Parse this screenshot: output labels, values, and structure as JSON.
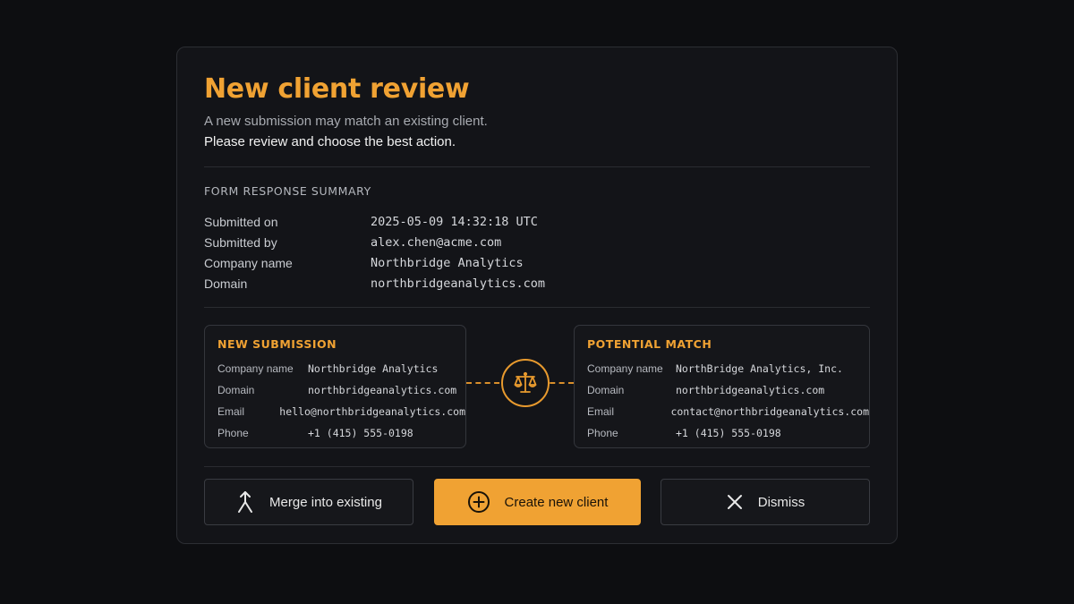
{
  "header": {
    "title": "New client review",
    "subtitle": "A new submission may match an existing client.",
    "instruction": "Please review and choose the best action."
  },
  "summary": {
    "section_title": "FORM RESPONSE SUMMARY",
    "rows": [
      {
        "label": "Submitted on",
        "value": "2025-05-09 14:32:18 UTC"
      },
      {
        "label": "Submitted by",
        "value": "alex.chen@acme.com"
      },
      {
        "label": "Company name",
        "value": "Northbridge Analytics"
      },
      {
        "label": "Domain",
        "value": "northbridgeanalytics.com"
      }
    ]
  },
  "new_submission": {
    "title": "NEW SUBMISSION",
    "rows": [
      {
        "label": "Company name",
        "value": "Northbridge Analytics"
      },
      {
        "label": "Domain",
        "value": "northbridgeanalytics.com"
      },
      {
        "label": "Email",
        "value": "hello@northbridgeanalytics.com"
      },
      {
        "label": "Phone",
        "value": "+1 (415) 555-0198"
      }
    ]
  },
  "potential_match": {
    "title": "POTENTIAL MATCH",
    "rows": [
      {
        "label": "Company name",
        "value": "NorthBridge Analytics, Inc."
      },
      {
        "label": "Domain",
        "value": "northbridgeanalytics.com"
      },
      {
        "label": "Email",
        "value": "contact@northbridgeanalytics.com"
      },
      {
        "label": "Phone",
        "value": "+1 (415) 555-0198"
      }
    ]
  },
  "compare_icon": "scale-icon",
  "actions": {
    "merge_label": "Merge into existing",
    "merge_icon": "merge-arrow-icon",
    "create_label": "Create new client",
    "create_icon": "plus-circle-icon",
    "dismiss_label": "Dismiss",
    "dismiss_icon": "close-icon"
  },
  "colors": {
    "accent": "#f0a233",
    "background": "#0d0e11",
    "card": "#131418"
  }
}
